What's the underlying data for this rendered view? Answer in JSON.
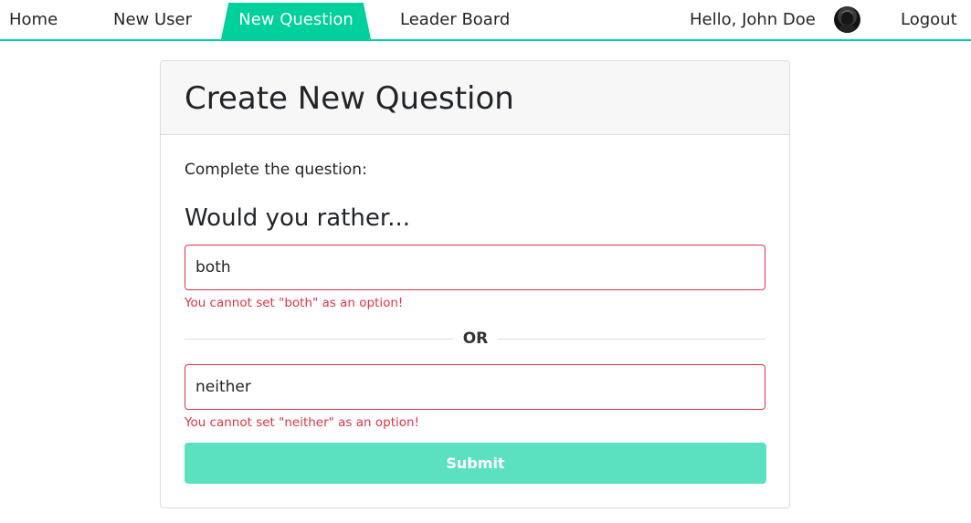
{
  "nav": {
    "items": [
      {
        "label": "Home"
      },
      {
        "label": "New User"
      },
      {
        "label": "New Question",
        "active": true
      },
      {
        "label": "Leader Board"
      }
    ],
    "greeting": "Hello, John Doe",
    "logout_label": "Logout",
    "accent_color": "#00d09c"
  },
  "card": {
    "title": "Create New Question",
    "prompt": "Complete the question:",
    "heading": "Would you rather...",
    "option_one": {
      "value": "both",
      "error": "You cannot set \"both\" as an option!"
    },
    "divider_label": "OR",
    "option_two": {
      "value": "neither",
      "error": "You cannot set \"neither\" as an option!"
    },
    "submit_label": "Submit",
    "submit_color": "#5be0c0",
    "error_color": "#dc3545"
  }
}
